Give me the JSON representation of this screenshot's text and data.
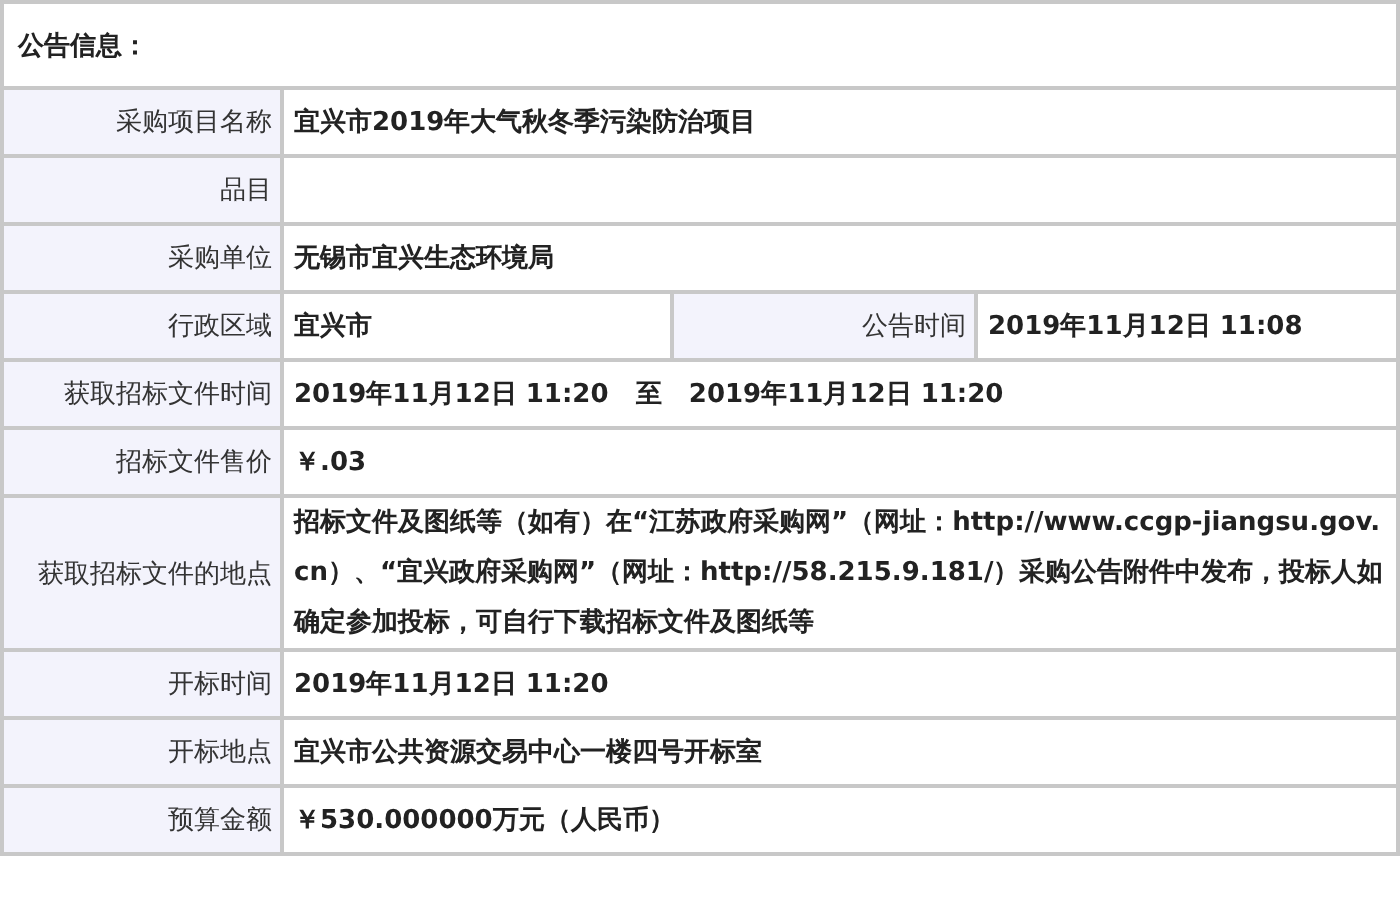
{
  "title": "公告信息：",
  "rows": [
    {
      "cells": [
        {
          "kind": "label",
          "text": "采购项目名称"
        },
        {
          "kind": "value",
          "text": "宜兴市2019年大气秋冬季污染防治项目"
        }
      ]
    },
    {
      "cells": [
        {
          "kind": "label",
          "text": "品目"
        },
        {
          "kind": "value"
        }
      ]
    },
    {
      "cells": [
        {
          "kind": "label",
          "text": "采购单位"
        },
        {
          "kind": "value",
          "text": "无锡市宜兴生态环境局"
        }
      ]
    },
    {
      "cells": [
        {
          "kind": "label",
          "text": "行政区域"
        },
        {
          "kind": "value",
          "text": "宜兴市"
        },
        {
          "kind": "label",
          "text": "公告时间"
        },
        {
          "kind": "value",
          "text": "2019年11月12日 11:08"
        }
      ]
    },
    {
      "cells": [
        {
          "kind": "label",
          "text": "获取招标文件时间"
        },
        {
          "kind": "value",
          "text": "2019年11月12日 11:20   至   2019年11月12日 11:20"
        }
      ]
    },
    {
      "cells": [
        {
          "kind": "label",
          "text": "招标文件售价"
        },
        {
          "kind": "value",
          "text": "￥.03"
        }
      ]
    },
    {
      "cells": [
        {
          "kind": "label",
          "text": "获取招标文件的地点"
        },
        {
          "kind": "value",
          "text": "招标文件及图纸等（如有）在“江苏政府采购网”（网址：http://www.ccgp-jiangsu.gov.cn）、“宜兴政府采购网”（网址：http://58.215.9.181/）采购公告附件中发布，投标人如确定参加投标，可自行下载招标文件及图纸等"
        }
      ]
    },
    {
      "cells": [
        {
          "kind": "label",
          "text": "开标时间"
        },
        {
          "kind": "value",
          "text": "2019年11月12日 11:20"
        }
      ]
    },
    {
      "cells": [
        {
          "kind": "label",
          "text": "开标地点"
        },
        {
          "kind": "value",
          "text": "宜兴市公共资源交易中心一楼四号开标室"
        }
      ]
    },
    {
      "cells": [
        {
          "kind": "label",
          "text": "预算金额"
        },
        {
          "kind": "value",
          "text": "￥530.000000万元（人民币）"
        }
      ]
    }
  ]
}
